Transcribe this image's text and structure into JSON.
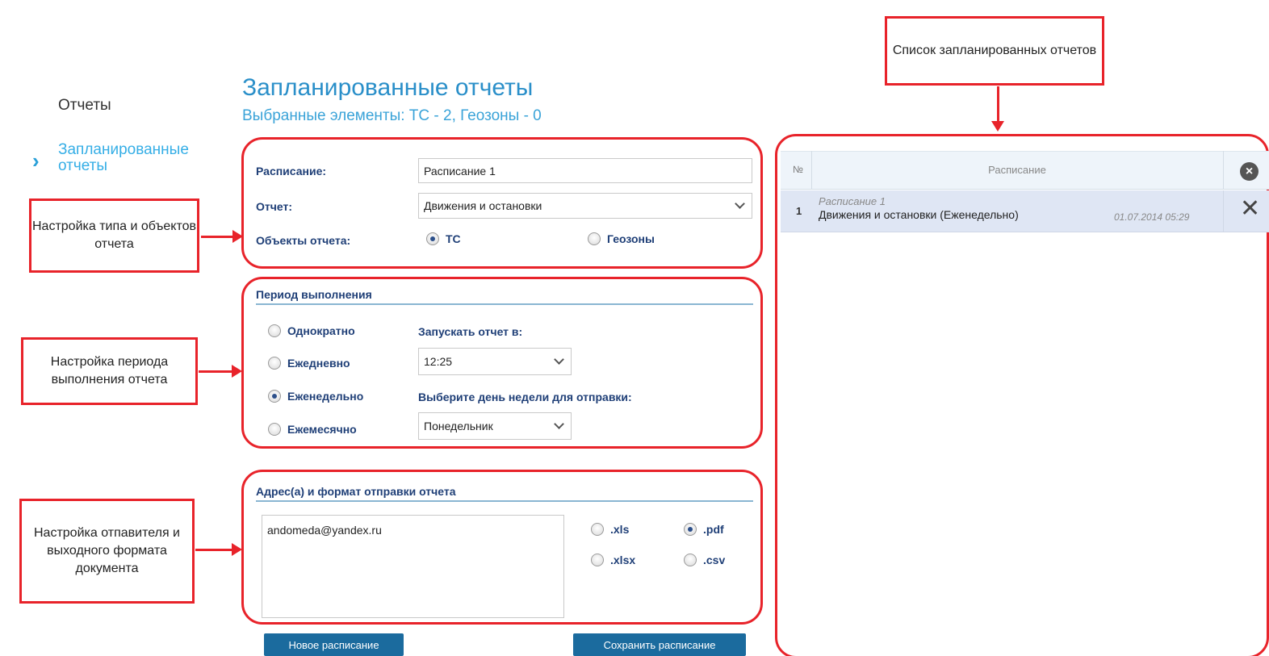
{
  "sidebar": {
    "items": [
      {
        "label": "Отчеты"
      },
      {
        "label": "Запланированные отчеты",
        "active": true
      }
    ]
  },
  "header": {
    "title": "Запланированные отчеты",
    "subtitle": "Выбранные элементы: ТС - 2, Геозоны - 0"
  },
  "form": {
    "schedule_label": "Расписание:",
    "schedule_value": "Расписание 1",
    "report_label": "Отчет:",
    "report_value": "Движения и остановки",
    "objects_label": "Объекты отчета:",
    "objects_options": [
      {
        "label": "ТС",
        "selected": true
      },
      {
        "label": "Геозоны",
        "selected": false
      }
    ]
  },
  "period": {
    "title": "Период выполнения",
    "options": [
      {
        "label": "Однократно",
        "selected": false
      },
      {
        "label": "Ежедневно",
        "selected": false
      },
      {
        "label": "Еженедельно",
        "selected": true
      },
      {
        "label": "Ежемесячно",
        "selected": false
      }
    ],
    "run_at_label": "Запускать отчет в:",
    "run_at_value": "12:25",
    "weekday_label": "Выберите день недели для отправки:",
    "weekday_value": "Понедельник"
  },
  "delivery": {
    "title": "Адрес(а) и формат отправки отчета",
    "emails": "andomeda@yandex.ru",
    "formats": [
      {
        "label": ".xls",
        "selected": false
      },
      {
        "label": ".pdf",
        "selected": true
      },
      {
        "label": ".xlsx",
        "selected": false
      },
      {
        "label": ".csv",
        "selected": false
      }
    ]
  },
  "buttons": {
    "new_schedule": "Новое расписание",
    "save_schedule": "Сохранить расписание"
  },
  "schedule_list": {
    "columns": [
      "№",
      "Расписание"
    ],
    "rows": [
      {
        "number": "1",
        "name": "Расписание 1",
        "description": "Движения и остановки (Еженедельно)",
        "created": "01.07.2014 05:29"
      }
    ]
  },
  "callouts": {
    "type_objects": "Настройка типа и объектов отчета",
    "period": "Настройка периода выполнения отчета",
    "sender_format": "Настройка отпавителя и выходного формата документа",
    "list": "Список запланированных отчетов"
  },
  "colors": {
    "accent": "#2a8fc9",
    "callout_red": "#e8232a",
    "button_blue": "#1b6b9e",
    "label_navy": "#1f3f77"
  }
}
